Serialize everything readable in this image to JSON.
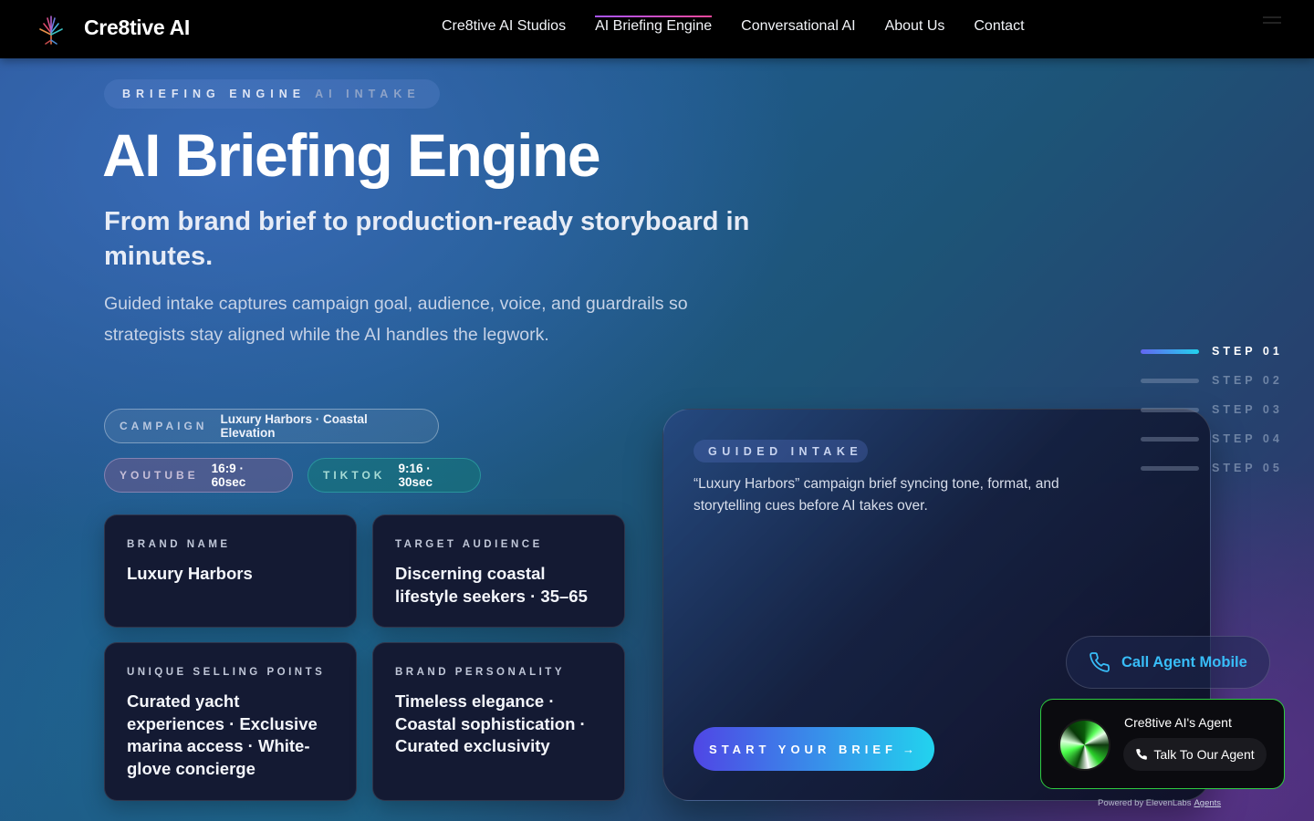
{
  "nav": {
    "brand": "Cre8tive AI",
    "links": [
      {
        "label": "Cre8tive AI Studios",
        "active": false
      },
      {
        "label": "AI Briefing Engine",
        "active": true
      },
      {
        "label": "Conversational AI",
        "active": false
      },
      {
        "label": "About Us",
        "active": false
      },
      {
        "label": "Contact",
        "active": false
      }
    ]
  },
  "hero": {
    "eyebrow_main": "BRIEFING ENGINE",
    "eyebrow_sub": "AI INTAKE",
    "title": "AI Briefing Engine",
    "subtitle": "From brand brief to production-ready storyboard in minutes.",
    "description": "Guided intake captures campaign goal, audience, voice, and guardrails so strategists stay aligned while the AI handles the legwork."
  },
  "pills": {
    "campaign": {
      "key": "CAMPAIGN",
      "value": "Luxury Harbors · Coastal Elevation"
    },
    "youtube": {
      "key": "YOUTUBE",
      "value": "16:9 · 60sec"
    },
    "tiktok": {
      "key": "TIKTOK",
      "value": "9:16 · 30sec"
    }
  },
  "cards": {
    "brand": {
      "label": "BRAND NAME",
      "value": "Luxury Harbors"
    },
    "audience": {
      "label": "TARGET AUDIENCE",
      "value": "Discerning coastal lifestyle seekers · 35–65"
    },
    "usp": {
      "label": "UNIQUE SELLING POINTS",
      "value": "Curated yacht experiences · Exclusive marina access · White-glove concierge"
    },
    "personality": {
      "label": "BRAND PERSONALITY",
      "value": "Timeless elegance · Coastal sophistication · Curated exclusivity"
    }
  },
  "intake": {
    "tag": "GUIDED INTAKE",
    "description": "“Luxury Harbors” campaign brief syncing tone, format, and storytelling cues before AI takes over.",
    "cta": "START YOUR BRIEF",
    "cta_arrow": "→"
  },
  "steps": [
    {
      "label": "STEP 01",
      "active": true
    },
    {
      "label": "STEP 02",
      "active": false
    },
    {
      "label": "STEP 03",
      "active": false
    },
    {
      "label": "STEP 04",
      "active": false
    },
    {
      "label": "STEP 05",
      "active": false
    }
  ],
  "call_agent": {
    "label": "Call Agent Mobile",
    "icon": "phone-icon"
  },
  "agent_widget": {
    "name": "Cre8tive AI's Agent",
    "button": "Talk To Our Agent",
    "powered_by": "Powered by ElevenLabs",
    "powered_link": "Agents"
  },
  "colors": {
    "accent_gradient_start": "#4f46e5",
    "accent_gradient_end": "#22d3ee",
    "nav_active_underline": "#a855f7",
    "agent_border": "#2ecc40",
    "call_text": "#38bdf8"
  }
}
